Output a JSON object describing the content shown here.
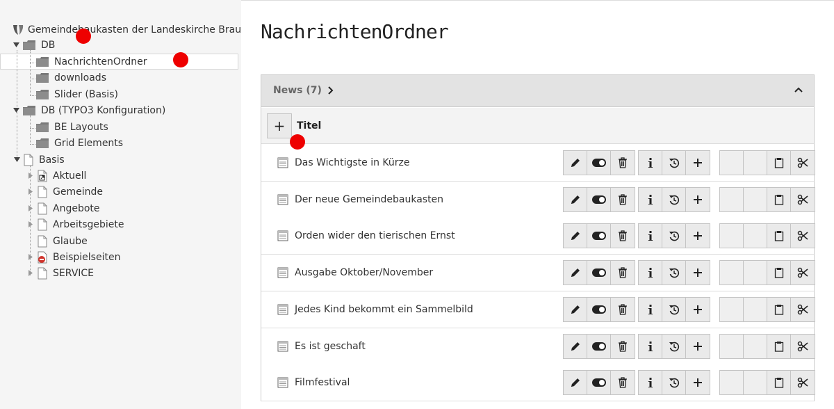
{
  "tree": {
    "root": {
      "label": "Gemeindebaukasten der Landeskirche Braun",
      "icon": "typo3-logo-icon"
    },
    "nodes": [
      {
        "label": "DB",
        "icon": "folder-icon"
      },
      {
        "label": "NachrichtenOrdner",
        "icon": "folder-icon",
        "selected": true
      },
      {
        "label": "downloads",
        "icon": "folder-icon"
      },
      {
        "label": "Slider (Basis)",
        "icon": "folder-icon"
      },
      {
        "label": "DB (TYPO3 Konfiguration)",
        "icon": "folder-icon"
      },
      {
        "label": "BE Layouts",
        "icon": "folder-icon"
      },
      {
        "label": "Grid Elements",
        "icon": "folder-icon"
      },
      {
        "label": "Basis",
        "icon": "page-icon"
      },
      {
        "label": "Aktuell",
        "icon": "page-shortcut-icon"
      },
      {
        "label": "Gemeinde",
        "icon": "page-icon"
      },
      {
        "label": "Angebote",
        "icon": "page-icon"
      },
      {
        "label": "Arbeitsgebiete",
        "icon": "page-icon"
      },
      {
        "label": "Glaube",
        "icon": "page-icon"
      },
      {
        "label": "Beispielseiten",
        "icon": "page-restricted-icon"
      },
      {
        "label": "SERVICE",
        "icon": "page-icon"
      }
    ]
  },
  "main": {
    "title": "NachrichtenOrdner",
    "panel": {
      "header": "News (7)",
      "column_label": "Titel",
      "add_label": "+",
      "records": [
        {
          "title": "Das Wichtigste in Kürze"
        },
        {
          "title": "Der neue Gemeindebaukasten"
        },
        {
          "title": "Orden wider den tierischen Ernst"
        },
        {
          "title": "Ausgabe Oktober/November"
        },
        {
          "title": "Jedes Kind bekommt ein Sammelbild"
        },
        {
          "title": "Es ist geschaft"
        },
        {
          "title": "Filmfestival"
        }
      ]
    }
  },
  "colors": {
    "tree_bg": "#f5f5f5",
    "panel_header_bg": "#e3e3e3",
    "button_bg": "#eaeaea",
    "annotation_dot": "#ee0000"
  }
}
